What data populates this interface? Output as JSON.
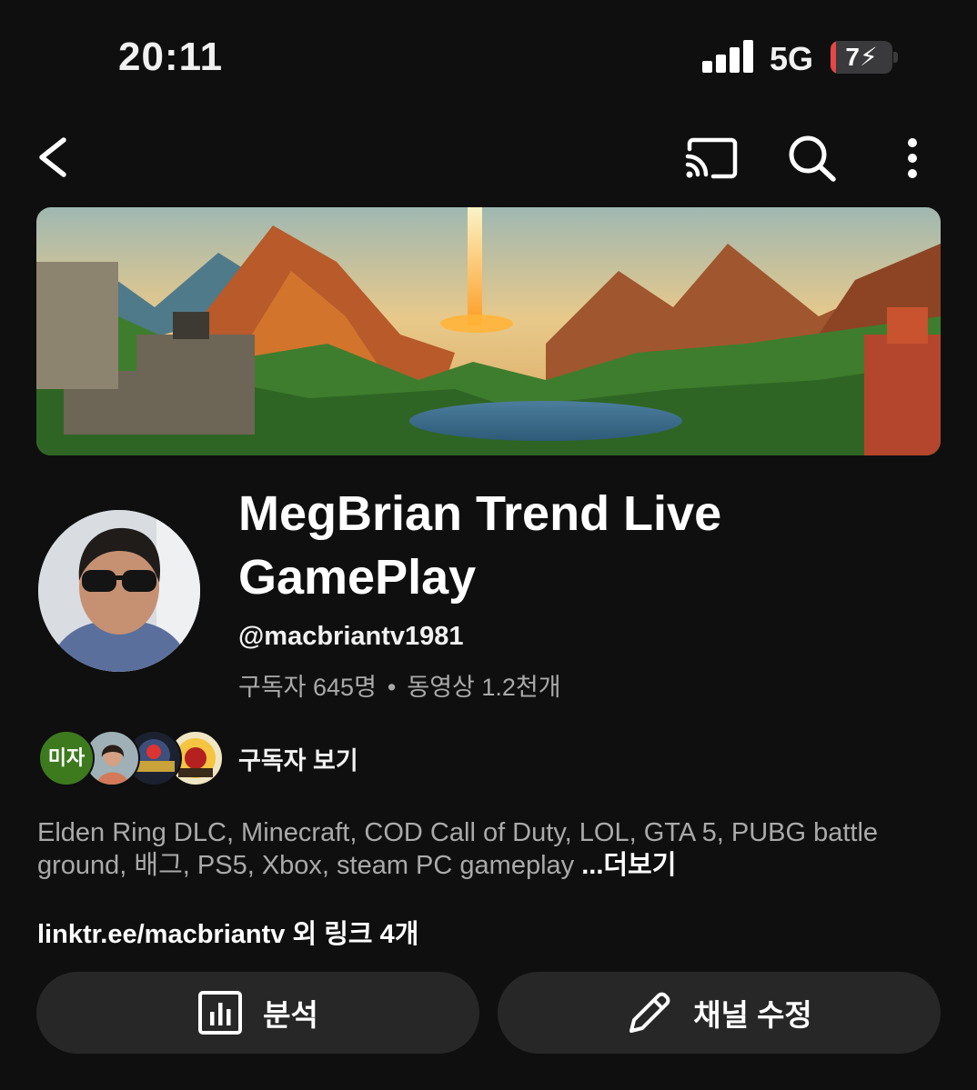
{
  "status": {
    "time": "20:11",
    "network": "5G",
    "battery_level": "7",
    "battery_fraction": 0.07
  },
  "topbar": {
    "back_icon": "chevron-left-icon",
    "cast_icon": "cast-icon",
    "search_icon": "search-icon",
    "more_icon": "more-vert-icon"
  },
  "channel": {
    "title": "MegBrian Trend Live GamePlay",
    "handle": "@macbriantv1981",
    "subscribers": "구독자 645명",
    "videos": "동영상 1.2천개",
    "separator": "•"
  },
  "subscribers_preview": {
    "first_avatar_text": "미자",
    "label": "구독자 보기"
  },
  "description": {
    "text": "Elden Ring DLC, Minecraft, COD Call of Duty, LOL, GTA 5, PUBG battle ground, 배그, PS5, Xbox, steam PC gameplay ",
    "more": "...더보기"
  },
  "links": {
    "text": "linktr.ee/macbriantv 외 링크 4개"
  },
  "actions": {
    "analytics_label": "분석",
    "edit_label": "채널 수정"
  },
  "colors": {
    "background": "#0f0f0f",
    "button": "#272727",
    "secondary_text": "#aaaaaa",
    "battery_low": "#e54646"
  }
}
